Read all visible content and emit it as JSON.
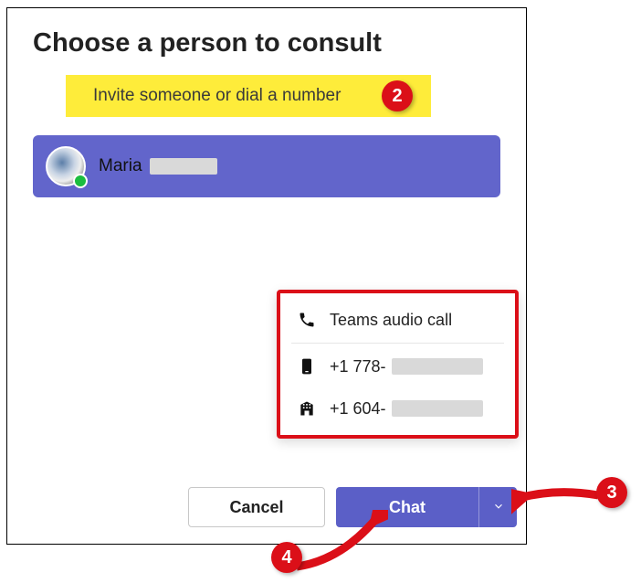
{
  "title": "Choose a person to consult",
  "search": {
    "placeholder": "Invite someone or dial a number"
  },
  "selected_person": {
    "name": "Maria",
    "presence": "available"
  },
  "menu": {
    "teams_call": "Teams audio call",
    "phone1_prefix": "+1 778-",
    "phone2_prefix": "+1 604-"
  },
  "buttons": {
    "cancel": "Cancel",
    "chat": "Chat"
  },
  "annotations": {
    "b2": "2",
    "b3": "3",
    "b4": "4"
  }
}
